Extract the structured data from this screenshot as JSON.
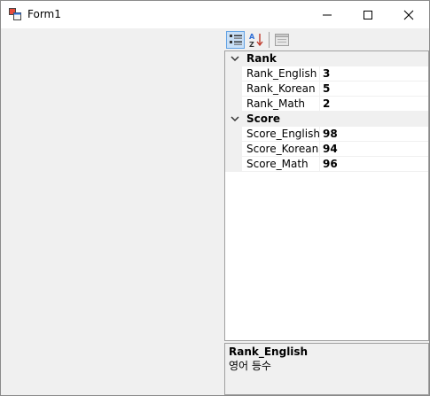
{
  "window": {
    "title": "Form1"
  },
  "propertyGrid": {
    "categories": [
      {
        "label": "Rank",
        "properties": [
          {
            "name": "Rank_English",
            "value": "3"
          },
          {
            "name": "Rank_Korean",
            "value": "5"
          },
          {
            "name": "Rank_Math",
            "value": "2"
          }
        ]
      },
      {
        "label": "Score",
        "properties": [
          {
            "name": "Score_English",
            "value": "98"
          },
          {
            "name": "Score_Korean",
            "value": "94"
          },
          {
            "name": "Score_Math",
            "value": "96"
          }
        ]
      }
    ],
    "help": {
      "title": "Rank_English",
      "description": "영어 등수"
    }
  },
  "icons": {
    "app": "form-app-icon",
    "minimize": "minimize-icon",
    "maximize": "maximize-icon",
    "close": "close-icon",
    "categorized": "categorized-icon",
    "alphabetical": "alphabetical-sort-icon",
    "propertyPages": "property-pages-icon",
    "expand": "chevron-down-icon"
  },
  "colors": {
    "selectedButton": "#c9e0f7",
    "selectedButtonBorder": "#62a2e4",
    "margin": "#f0f0f0"
  }
}
